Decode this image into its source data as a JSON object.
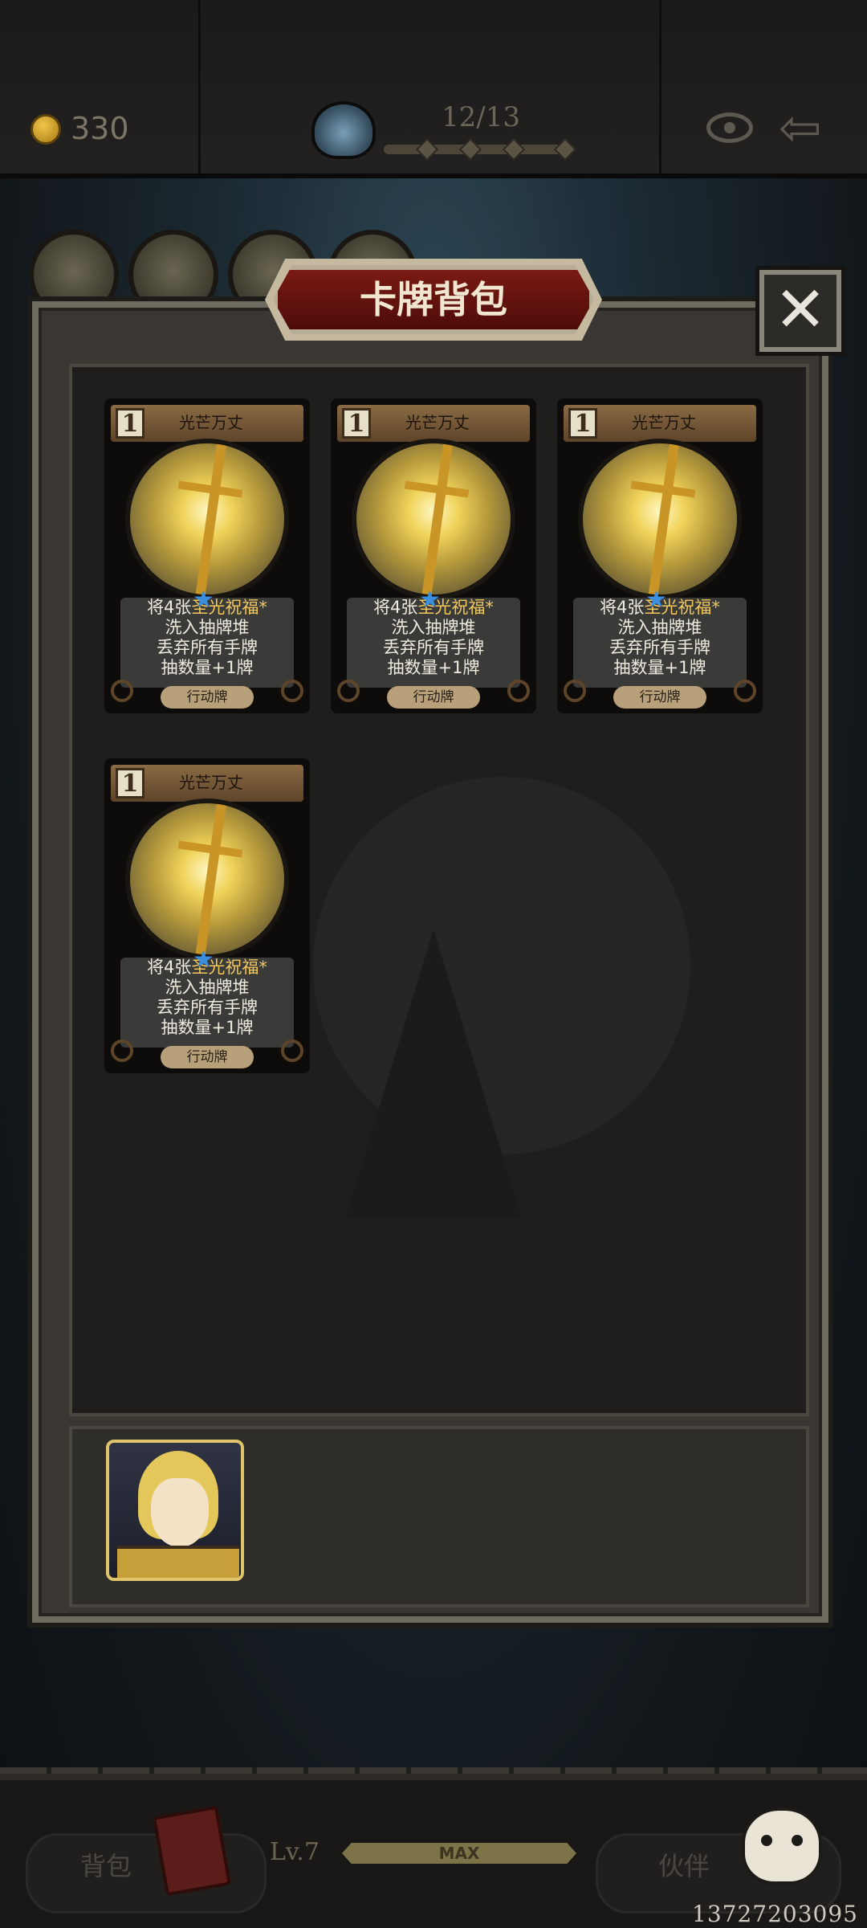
{
  "header": {
    "coins": "330",
    "progress": "12/13",
    "progress_current": 12,
    "progress_total": 13
  },
  "popup": {
    "title": "卡牌背包",
    "close_symbol": "✕"
  },
  "cards": [
    {
      "cost": "1",
      "name": "光芒万丈",
      "desc_prefix": "将4张",
      "desc_highlight": "圣光祝福*",
      "desc_lines": [
        "洗入抽牌堆",
        "丢弃所有手牌",
        "抽数量+1牌"
      ],
      "type": "行动牌",
      "star": "★"
    },
    {
      "cost": "1",
      "name": "光芒万丈",
      "desc_prefix": "将4张",
      "desc_highlight": "圣光祝福*",
      "desc_lines": [
        "洗入抽牌堆",
        "丢弃所有手牌",
        "抽数量+1牌"
      ],
      "type": "行动牌",
      "star": "★"
    },
    {
      "cost": "1",
      "name": "光芒万丈",
      "desc_prefix": "将4张",
      "desc_highlight": "圣光祝福*",
      "desc_lines": [
        "洗入抽牌堆",
        "丢弃所有手牌",
        "抽数量+1牌"
      ],
      "type": "行动牌",
      "star": "★"
    },
    {
      "cost": "1",
      "name": "光芒万丈",
      "desc_prefix": "将4张",
      "desc_highlight": "圣光祝福*",
      "desc_lines": [
        "洗入抽牌堆",
        "丢弃所有手牌",
        "抽数量+1牌"
      ],
      "type": "行动牌",
      "star": "★"
    }
  ],
  "footer": {
    "bag_label": "背包",
    "level": "Lv.7",
    "level_status": "MAX",
    "partner_label": "伙伴",
    "watermark": "13727203095"
  },
  "colors": {
    "accent_gold": "#f2c85c",
    "title_red": "#7a1a14",
    "star_blue": "#3b8fe0"
  },
  "icons": {
    "coin": "coin-icon",
    "portal": "portal-icon",
    "view": "eye-icon",
    "back": "back-arrow-icon",
    "close": "close-icon",
    "bag": "backpack-icon",
    "partner": "dog-partner-icon"
  }
}
